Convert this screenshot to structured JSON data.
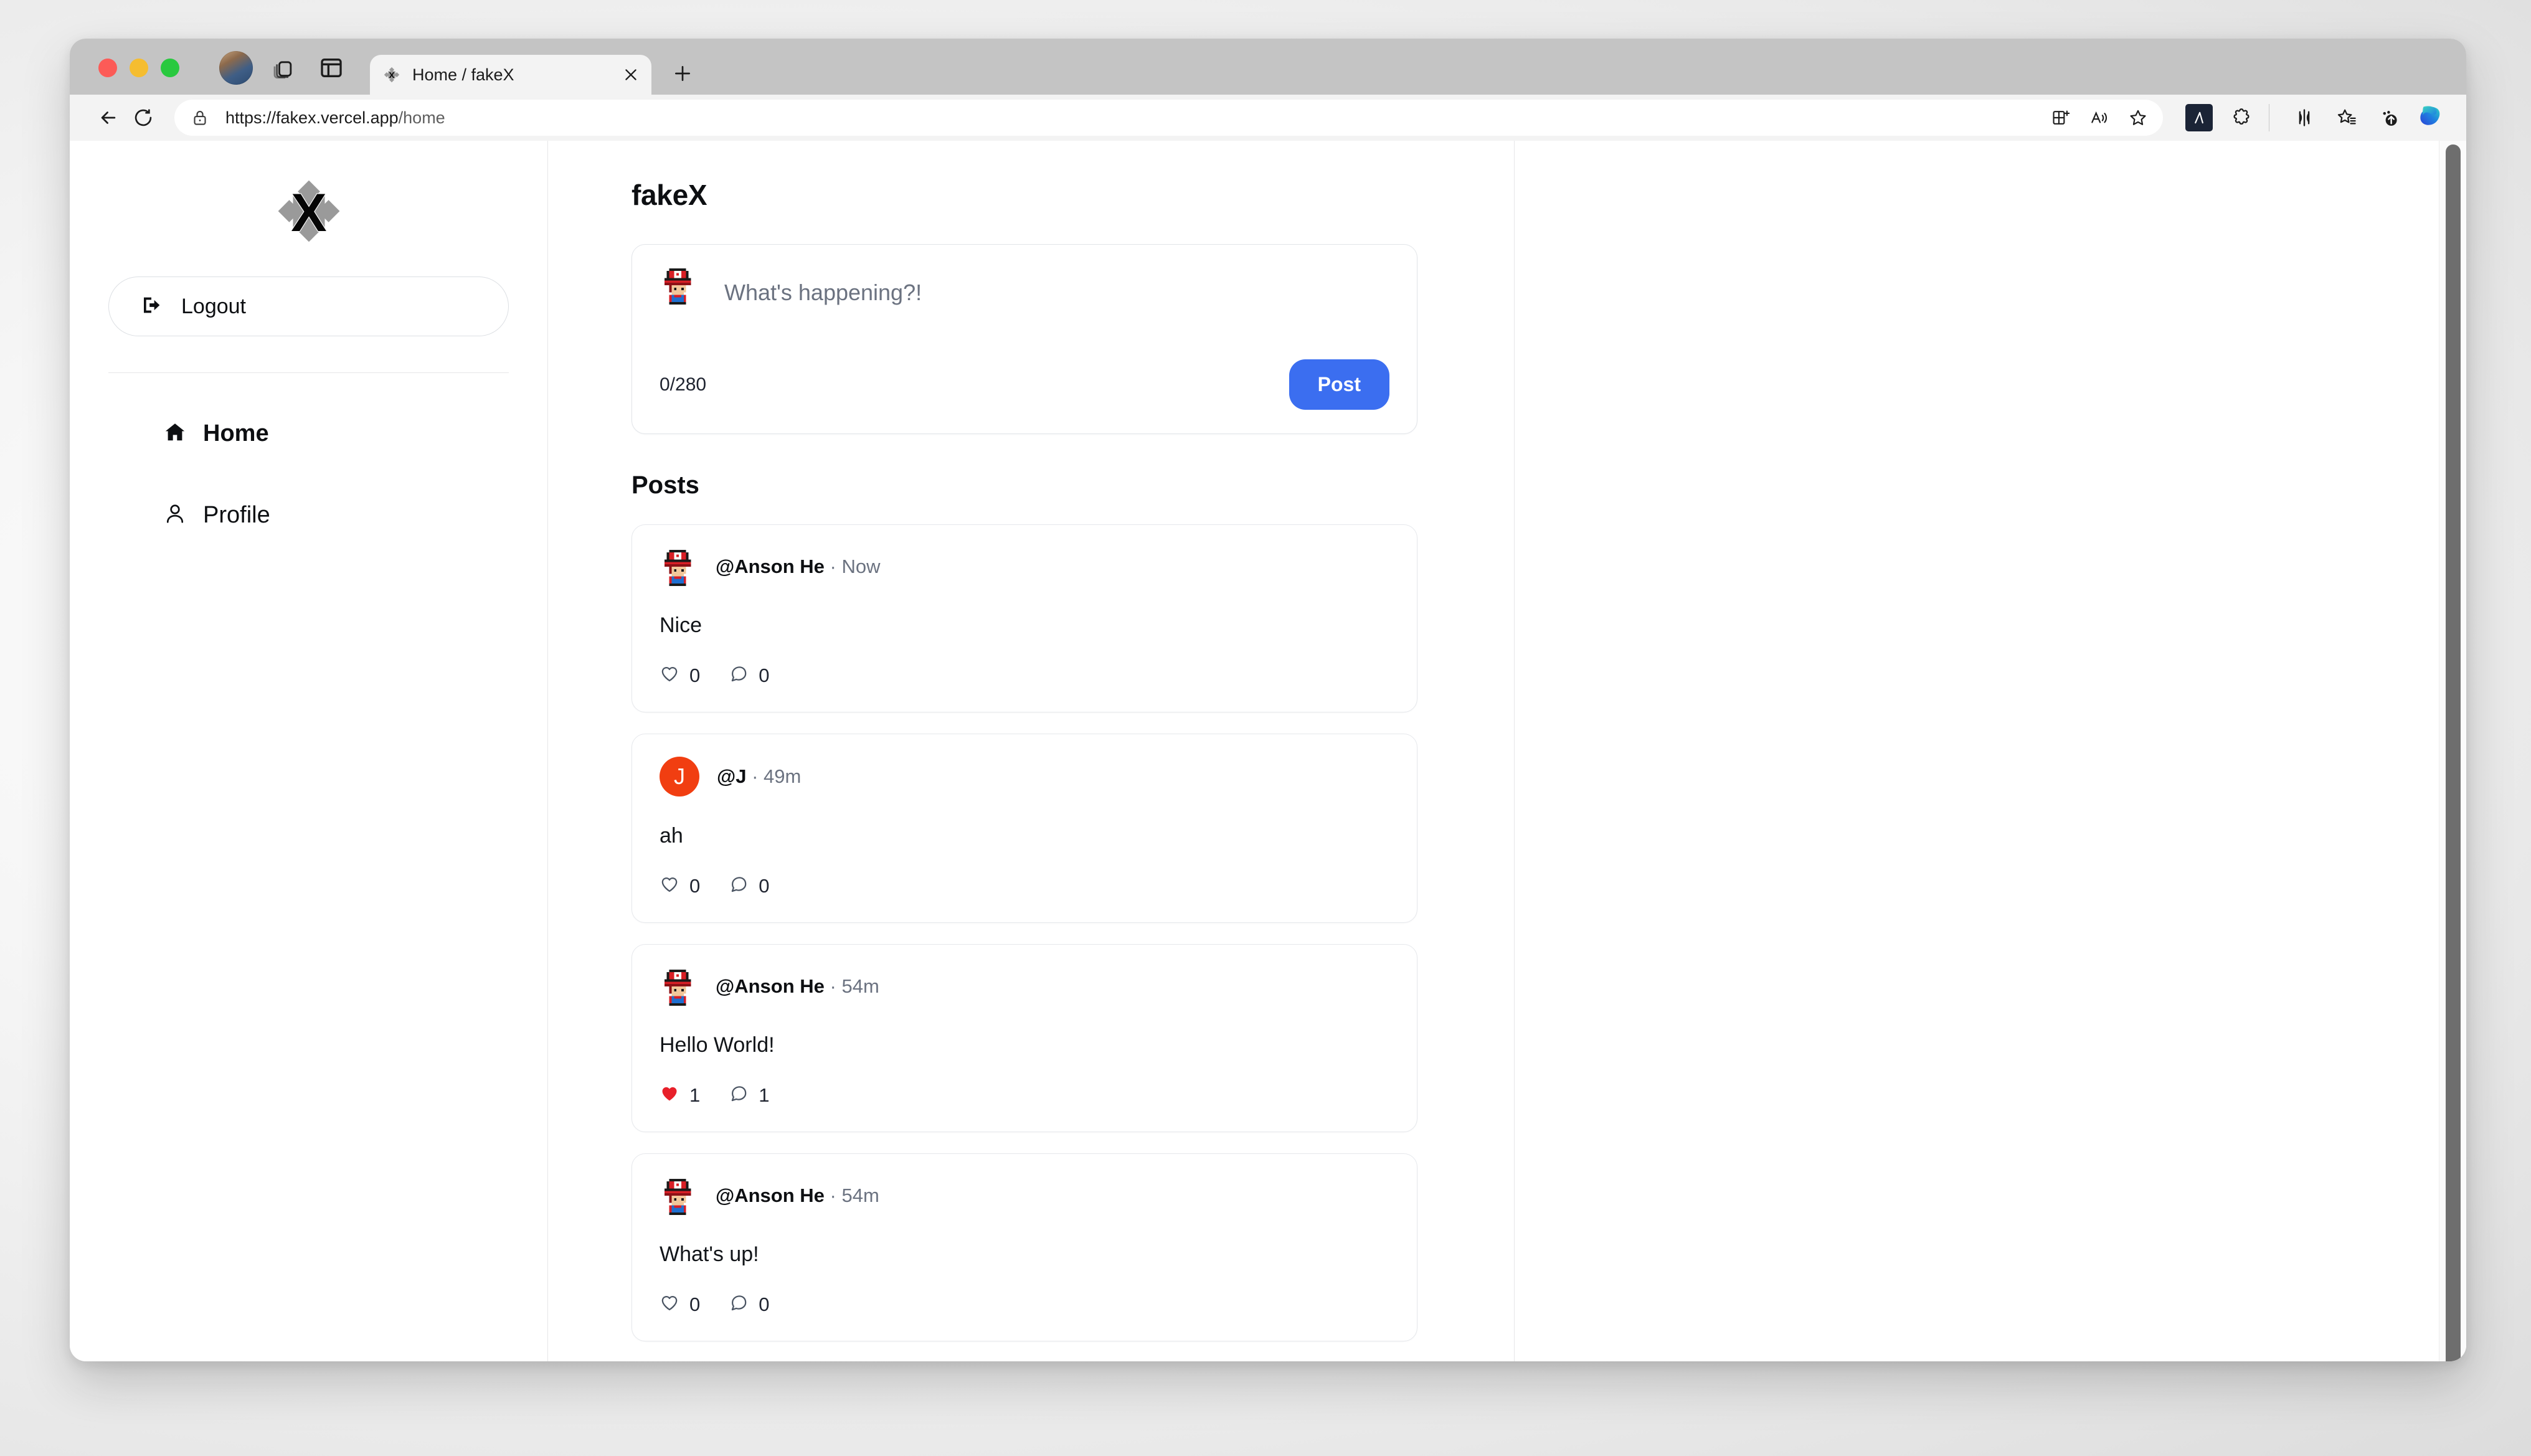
{
  "browser": {
    "tab": {
      "title": "Home / fakeX",
      "favicon_icon": "fakex-star-x-icon",
      "close_icon": "close-icon"
    },
    "new_tab_icon": "plus-icon",
    "traffic_lights": [
      "close-red",
      "minimize-yellow",
      "maximize-green"
    ],
    "chrome_icons": [
      "profile-avatar",
      "copilot-pages-icon",
      "split-pane-icon"
    ],
    "toolbar": {
      "back_icon": "back-arrow-icon",
      "reload_icon": "reload-icon",
      "lock_icon": "lock-icon",
      "url_prefix": "https://fakex.vercel.app",
      "url_suffix": "/home",
      "url_full": "https://fakex.vercel.app/home",
      "address_icons": [
        "split-screen-add-icon",
        "read-aloud-icon",
        "favorite-star-icon"
      ],
      "right_icons": [
        "extension-dark-icon",
        "extensions-puzzle-icon",
        "browser-essentials-icon",
        "favorites-star-list-icon",
        "settings-more-icon",
        "copilot-icon"
      ]
    }
  },
  "sidebar": {
    "logo_icon": "fakex-star-x-logo",
    "logout": {
      "label": "Logout",
      "icon": "logout-icon"
    },
    "nav": [
      {
        "label": "Home",
        "icon": "home-icon",
        "active": true
      },
      {
        "label": "Profile",
        "icon": "person-icon",
        "active": false
      }
    ]
  },
  "main": {
    "title": "fakeX",
    "composer": {
      "avatar": "pixel-mario-avatar",
      "placeholder": "What's happening?!",
      "value": "",
      "counter": "0/280",
      "post_label": "Post",
      "post_color": "#3b6ef0"
    },
    "posts_heading": "Posts",
    "posts": [
      {
        "avatar_type": "pixel",
        "avatar_letter": "",
        "handle": "@Anson He",
        "separator": " · ",
        "time": "Now",
        "text": "Nice",
        "like_icon": "heart-outline-icon",
        "likes": "0",
        "liked": false,
        "comment_icon": "comment-icon",
        "comments": "0"
      },
      {
        "avatar_type": "letter",
        "avatar_letter": "J",
        "avatar_color": "#f13e11",
        "handle": "@J",
        "separator": " · ",
        "time": "49m",
        "text": "ah",
        "like_icon": "heart-outline-icon",
        "likes": "0",
        "liked": false,
        "comment_icon": "comment-icon",
        "comments": "0"
      },
      {
        "avatar_type": "pixel",
        "avatar_letter": "",
        "handle": "@Anson He",
        "separator": " · ",
        "time": "54m",
        "text": "Hello World!",
        "like_icon": "heart-filled-icon",
        "likes": "1",
        "liked": true,
        "like_color": "#e8202a",
        "comment_icon": "comment-icon",
        "comments": "1"
      },
      {
        "avatar_type": "pixel",
        "avatar_letter": "",
        "handle": "@Anson He",
        "separator": " · ",
        "time": "54m",
        "text": "What's up!",
        "like_icon": "heart-outline-icon",
        "likes": "0",
        "liked": false,
        "comment_icon": "comment-icon",
        "comments": "0"
      }
    ]
  }
}
